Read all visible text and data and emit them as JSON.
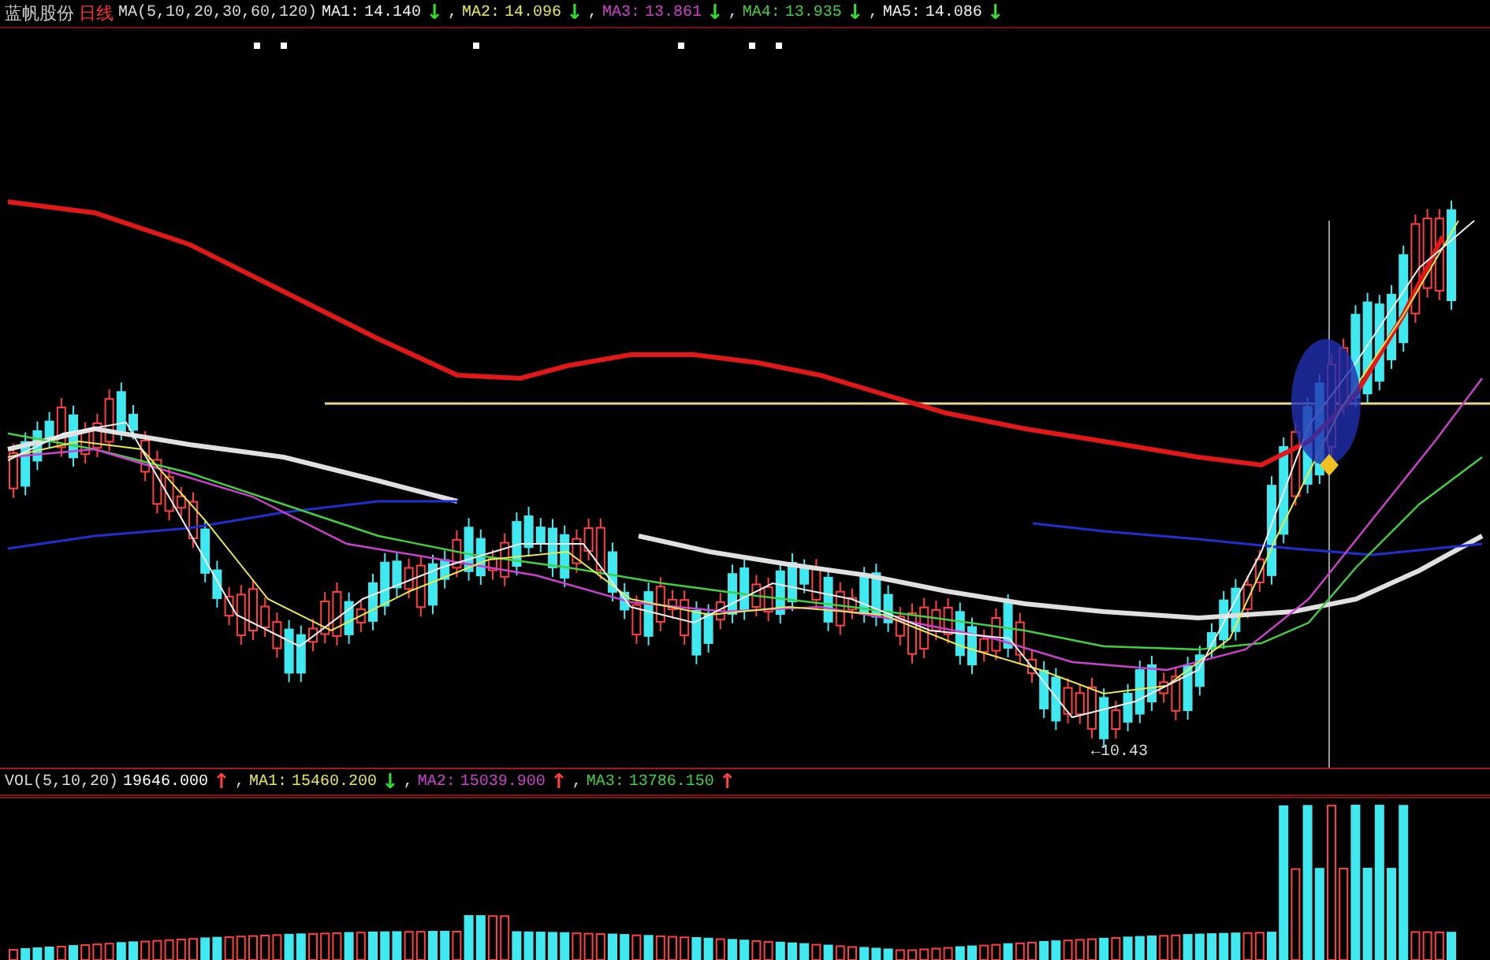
{
  "stock": {
    "name": "蓝帆股份",
    "period": "日线"
  },
  "price_indicator": {
    "label": "MA(5,10,20,30,60,120)",
    "lines": [
      {
        "label": "MA1:",
        "value": "14.140",
        "arrow": {
          "text": "↓",
          "color": "#30e030"
        },
        "separator": ",",
        "color": "#f0f0f0"
      },
      {
        "label": "MA2:",
        "value": "14.096",
        "arrow": {
          "text": "↓",
          "color": "#30e030"
        },
        "separator": ",",
        "color": "#e8e850"
      },
      {
        "label": "MA3:",
        "value": "13.861",
        "arrow": {
          "text": "↓",
          "color": "#30e030"
        },
        "separator": ",",
        "color": "#d040d0"
      },
      {
        "label": "MA4:",
        "value": "13.935",
        "arrow": {
          "text": "↓",
          "color": "#30e030"
        },
        "separator": ",",
        "color": "#40d040"
      },
      {
        "label": "MA5:",
        "value": "14.086",
        "arrow": {
          "text": "↓",
          "color": "#30e030"
        },
        "color": "#f0f0f0"
      }
    ]
  },
  "low_label": "←10.43",
  "volume_indicator": {
    "label": "VOL(5,10,20)",
    "value": "19646.000",
    "arrow": {
      "text": "↑",
      "color": "#ff4040"
    },
    "separator": ",",
    "lines": [
      {
        "label": "MA1:",
        "value": "15460.200",
        "arrow": {
          "text": "↓",
          "color": "#30e030"
        },
        "separator": ",",
        "color": "#e8e850"
      },
      {
        "label": "MA2:",
        "value": "15039.900",
        "arrow": {
          "text": "↑",
          "color": "#ff4040"
        },
        "separator": ",",
        "color": "#d040d0"
      },
      {
        "label": "MA3:",
        "value": "13786.150",
        "arrow": {
          "text": "↑",
          "color": "#ff4040"
        },
        "color": "#40d040"
      }
    ]
  }
}
